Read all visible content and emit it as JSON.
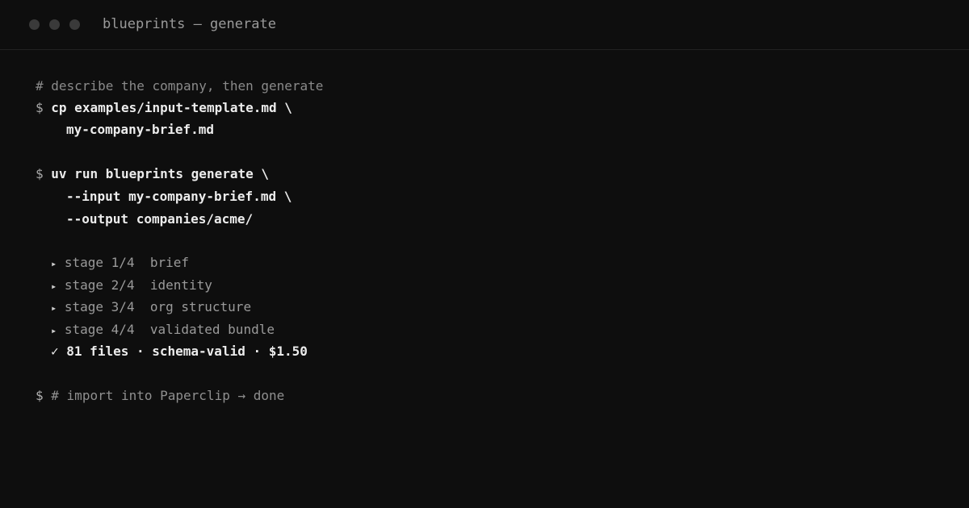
{
  "window": {
    "title": "blueprints — generate",
    "controls": [
      "close-dot",
      "minimize-dot",
      "maximize-dot"
    ]
  },
  "terminal": {
    "comment_line": "# describe the company, then generate",
    "cmd1": {
      "prompt": "$",
      "line1": "cp examples/input-template.md \\",
      "line2": "my-company-brief.md"
    },
    "cmd2": {
      "prompt": "$",
      "line1": "uv run blueprints generate \\",
      "line2": "--input my-company-brief.md \\",
      "line3": "--output companies/acme/"
    },
    "stages": [
      {
        "marker": "▸",
        "label": "stage 1/4",
        "name": "brief"
      },
      {
        "marker": "▸",
        "label": "stage 2/4",
        "name": "identity"
      },
      {
        "marker": "▸",
        "label": "stage 3/4",
        "name": "org structure"
      },
      {
        "marker": "▸",
        "label": "stage 4/4",
        "name": "validated bundle"
      }
    ],
    "result": {
      "marker": "✓",
      "text": "81 files · schema-valid · $1.50"
    },
    "final": {
      "prompt": "$",
      "text": "# import into Paperclip → done"
    }
  }
}
